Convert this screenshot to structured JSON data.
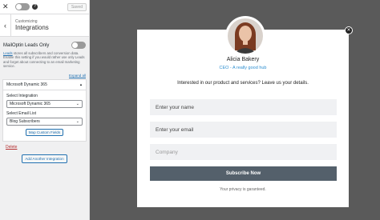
{
  "sidebar": {
    "saved_label": "Saved",
    "section_sub": "Customizing",
    "section_title": "Integrations",
    "optin_title": "MailOptin Leads Only",
    "desc_link": "Leads",
    "desc_text": " stores all subscribers and conversion data. Enable this setting if you would rather use only Leads and forget about connecting to an email marketing service.",
    "expand_all": "Expand all",
    "integration_name": "Microsoft Dynamic 365",
    "select_integration_label": "Select Integration",
    "select_integration_value": "Microsoft Dynamic 365",
    "select_list_label": "Select Email List",
    "select_list_value": "Blog Subscribers",
    "map_fields": "Map Custom Fields",
    "delete": "Delete",
    "add_integration": "Add Another Integration"
  },
  "modal": {
    "name": "Alicia Bakery",
    "role": "CEO - A really good hub",
    "headline": "Interested in our product and services? Leave us your details.",
    "name_placeholder": "Enter your name",
    "email_placeholder": "Enter your email",
    "company_placeholder": "Company",
    "subscribe": "Subscribe Now",
    "privacy": "Your privacy is garanteed."
  }
}
